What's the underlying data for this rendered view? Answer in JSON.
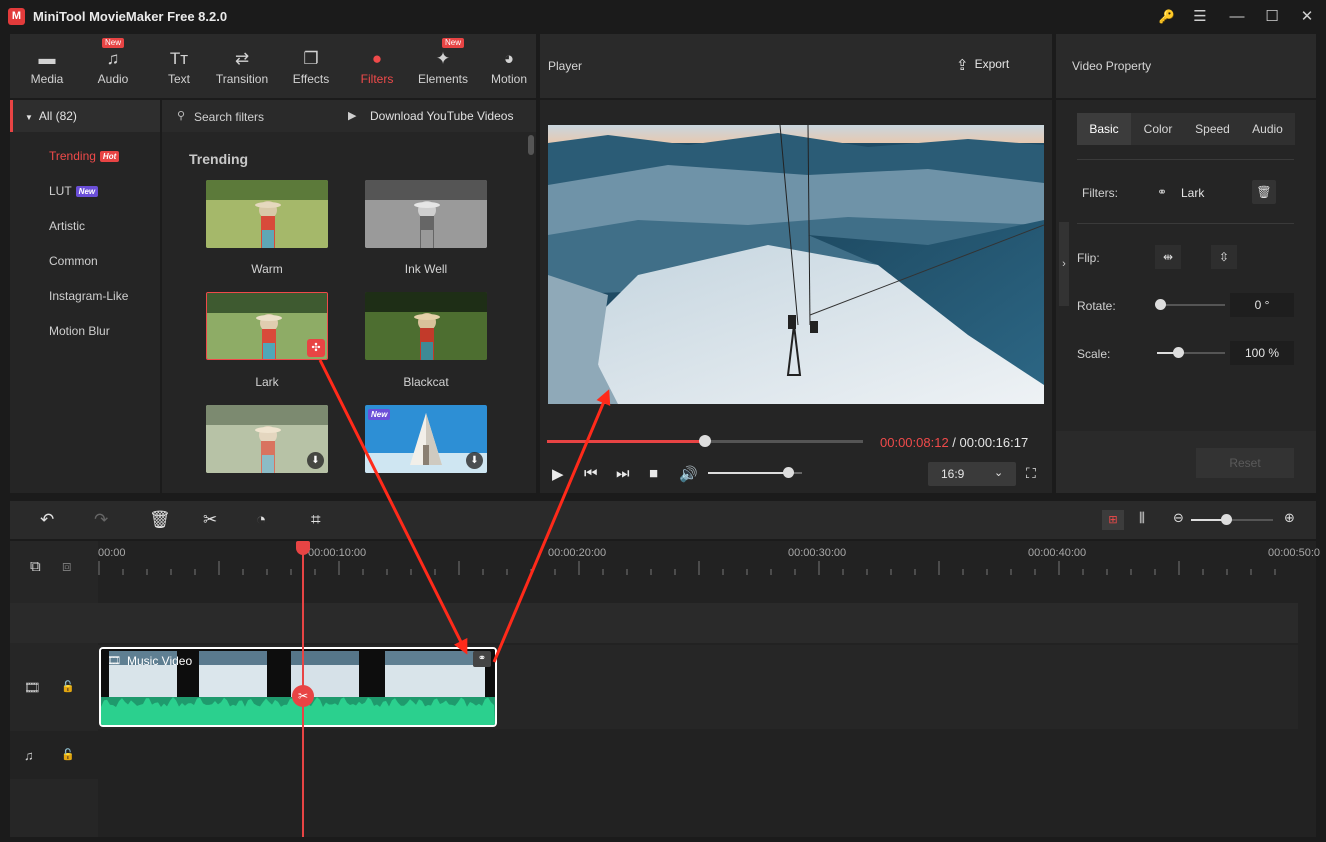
{
  "app": {
    "title": "MiniTool MovieMaker Free 8.2.0",
    "logo_letter": "M"
  },
  "window_controls": {
    "key_icon": "🔑",
    "menu_icon": "☰",
    "minimize_icon": "—",
    "maximize_icon": "☐",
    "close_icon": "✕"
  },
  "toolbar": {
    "items": [
      {
        "label": "Media",
        "icon": "▬"
      },
      {
        "label": "Audio",
        "icon": "♫",
        "badge": "New"
      },
      {
        "label": "Text",
        "icon": "Tт"
      },
      {
        "label": "Transition",
        "icon": "⇄"
      },
      {
        "label": "Effects",
        "icon": "❐"
      },
      {
        "label": "Filters",
        "icon": "●"
      },
      {
        "label": "Elements",
        "icon": "✦",
        "badge": "New"
      },
      {
        "label": "Motion",
        "icon": "◕"
      }
    ]
  },
  "categories": {
    "all_label": "All (82)",
    "items": [
      {
        "label": "Trending",
        "badge": "Hot"
      },
      {
        "label": "LUT",
        "badge": "New"
      },
      {
        "label": "Artistic"
      },
      {
        "label": "Common"
      },
      {
        "label": "Instagram-Like"
      },
      {
        "label": "Motion Blur"
      }
    ]
  },
  "filters": {
    "search_placeholder": "Search filters",
    "download_label": "Download YouTube Videos",
    "section_title": "Trending",
    "items": [
      {
        "label": "Warm"
      },
      {
        "label": "Ink Well"
      },
      {
        "label": "Lark"
      },
      {
        "label": "Blackcat"
      },
      {
        "label": ""
      },
      {
        "label": "",
        "badge": "New"
      }
    ]
  },
  "player": {
    "title": "Player",
    "export_label": "Export",
    "current_time": "00:00:08:12",
    "separator": " / ",
    "total_time": "00:00:16:17",
    "progress": 0.5,
    "volume": 0.85,
    "aspect_ratio": "16:9"
  },
  "properties": {
    "title": "Video Property",
    "tabs": [
      "Basic",
      "Color",
      "Speed",
      "Audio"
    ],
    "filters_label": "Filters:",
    "filter_value": "Lark",
    "flip_label": "Flip:",
    "rotate_label": "Rotate:",
    "rotate_value": "0 °",
    "scale_label": "Scale:",
    "scale_value": "100 %",
    "reset_label": "Reset"
  },
  "timeline": {
    "ruler_labels": [
      "00:00",
      "00:00:10:00",
      "00:00:20:00",
      "00:00:30:00",
      "00:00:40:00",
      "00:00:50:0"
    ],
    "clip_title": "Music Video",
    "playhead_time_seconds": 8.5
  },
  "colors": {
    "accent": "#ef4a4a",
    "audio_wave": "#2bb583",
    "panel": "#252525"
  }
}
